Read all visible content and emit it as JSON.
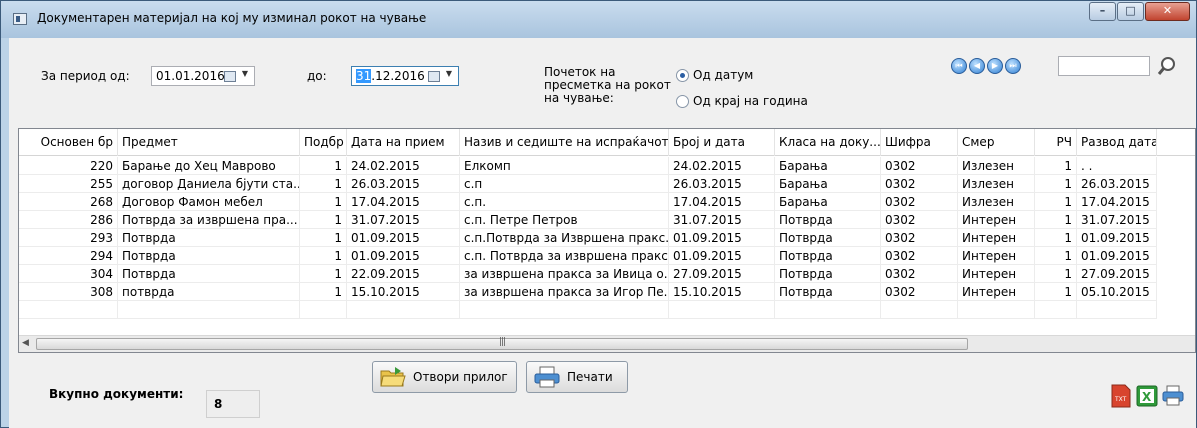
{
  "window": {
    "title": "Документарен материјал на кој му изминал рокот на чување",
    "buttons": [
      "minimize",
      "maximize",
      "close"
    ]
  },
  "filters": {
    "period_from_label": "За период од:",
    "date_from": "01.01.2016",
    "to_label": "до:",
    "date_to_selected": "31",
    "date_to_rest": ".12.2016",
    "calc_start_label_1": "Почеток на",
    "calc_start_label_2": "пресметка на рокот",
    "calc_start_label_3": "на чување:",
    "radio_from_date": "Од датум",
    "radio_from_year_end": "Од крај на година",
    "radio_selected": "from_date"
  },
  "nav": {
    "icons": [
      "first-icon",
      "prev-icon",
      "next-icon",
      "last-icon"
    ],
    "search_value": ""
  },
  "table": {
    "columns": [
      "Основен бр",
      "Предмет",
      "Подбр",
      "Дата на прием",
      "Назив и седиште на испраќачот",
      "Број и дата",
      "Класа на доку...",
      "Шифра",
      "Смер",
      "РЧ",
      "Развод дата"
    ],
    "rows": [
      [
        "220",
        "Барање до Хец Маврово",
        "1",
        "24.02.2015",
        "Елкомп",
        "24.02.2015",
        "Барања",
        "0302",
        "Излезен",
        "1",
        ". ."
      ],
      [
        "255",
        "договор Даниела бјути ста...",
        "1",
        "26.03.2015",
        "с.п",
        "26.03.2015",
        "Барања",
        "0302",
        "Излезен",
        "1",
        "26.03.2015"
      ],
      [
        "268",
        "Договор Фамон мебел",
        "1",
        "17.04.2015",
        "с.п.",
        "17.04.2015",
        "Барања",
        "0302",
        "Излезен",
        "1",
        "17.04.2015"
      ],
      [
        "286",
        "Потврда за извршена пра...",
        "1",
        "31.07.2015",
        "с.п. Петре Петров",
        "31.07.2015",
        "Потврда",
        "0302",
        "Интерен",
        "1",
        "31.07.2015"
      ],
      [
        "293",
        "Потврда",
        "1",
        "01.09.2015",
        "с.п.Потврда за Извршена пракс...",
        "01.09.2015",
        "Потврда",
        "0302",
        "Интерен",
        "1",
        "01.09.2015"
      ],
      [
        "294",
        "Потврда",
        "1",
        "01.09.2015",
        "с.п. Потврда за извршена пракс...",
        "01.09.2015",
        "Потврда",
        "0302",
        "Интерен",
        "1",
        "01.09.2015"
      ],
      [
        "304",
        "Потврда",
        "1",
        "22.09.2015",
        "за извршена пракса за Ивица о...",
        "27.09.2015",
        "Потврда",
        "0302",
        "Интерен",
        "1",
        "27.09.2015"
      ],
      [
        "308",
        "потврда",
        "1",
        "15.10.2015",
        "за извршена пракса за Игор Пе...",
        "15.10.2015",
        "Потврда",
        "0302",
        "Интерен",
        "1",
        "05.10.2015"
      ]
    ]
  },
  "footer": {
    "total_label": "Вкупно документи:",
    "total_value": "8",
    "open_attachment": "Отвори прилог",
    "print": "Печати",
    "export_icons": [
      "txt-export-icon",
      "excel-export-icon",
      "printer-icon"
    ]
  },
  "colors": {
    "selection": "#3399ff",
    "titlebar": "#b6cde4",
    "close_button": "#c1442f"
  }
}
